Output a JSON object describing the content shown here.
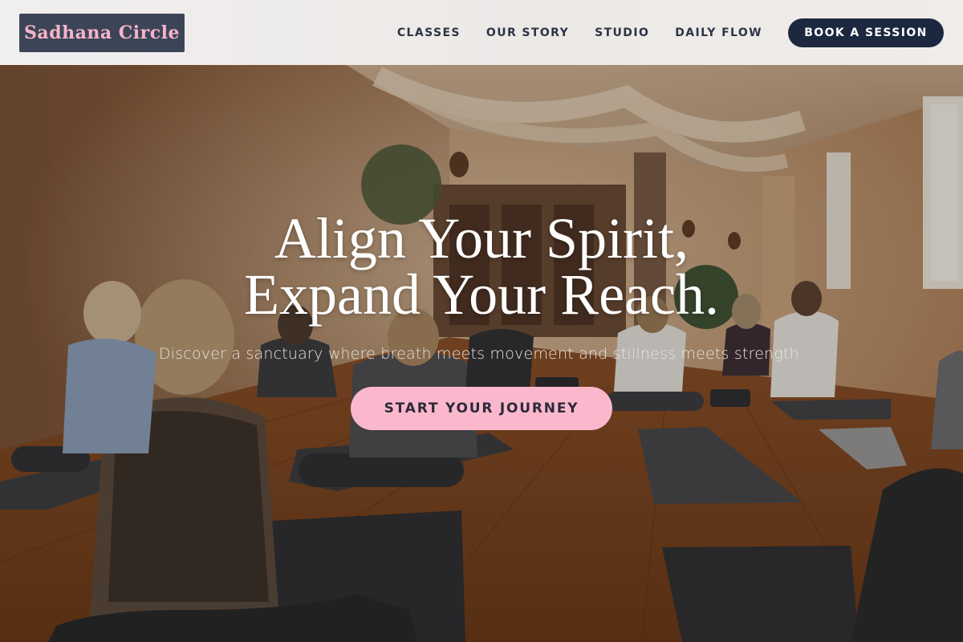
{
  "brand": {
    "name": "Sadhana Circle"
  },
  "nav": {
    "items": [
      {
        "label": "CLASSES"
      },
      {
        "label": "OUR STORY"
      },
      {
        "label": "STUDIO"
      },
      {
        "label": "DAILY FLOW"
      }
    ],
    "cta_label": "BOOK A SESSION"
  },
  "hero": {
    "headline_line1": "Align Your Spirit,",
    "headline_line2": "Expand Your Reach.",
    "subheadline": "Discover a sanctuary where breath meets movement and stillness meets strength.",
    "cta_label": "START YOUR JOURNEY"
  },
  "colors": {
    "logo_bg": "#3c4558",
    "logo_text": "#f6b4c8",
    "nav_text": "#2d3445",
    "book_button_bg": "#1c2740",
    "cta_bg": "#fbb8cd",
    "cta_text": "#2b2a38"
  }
}
